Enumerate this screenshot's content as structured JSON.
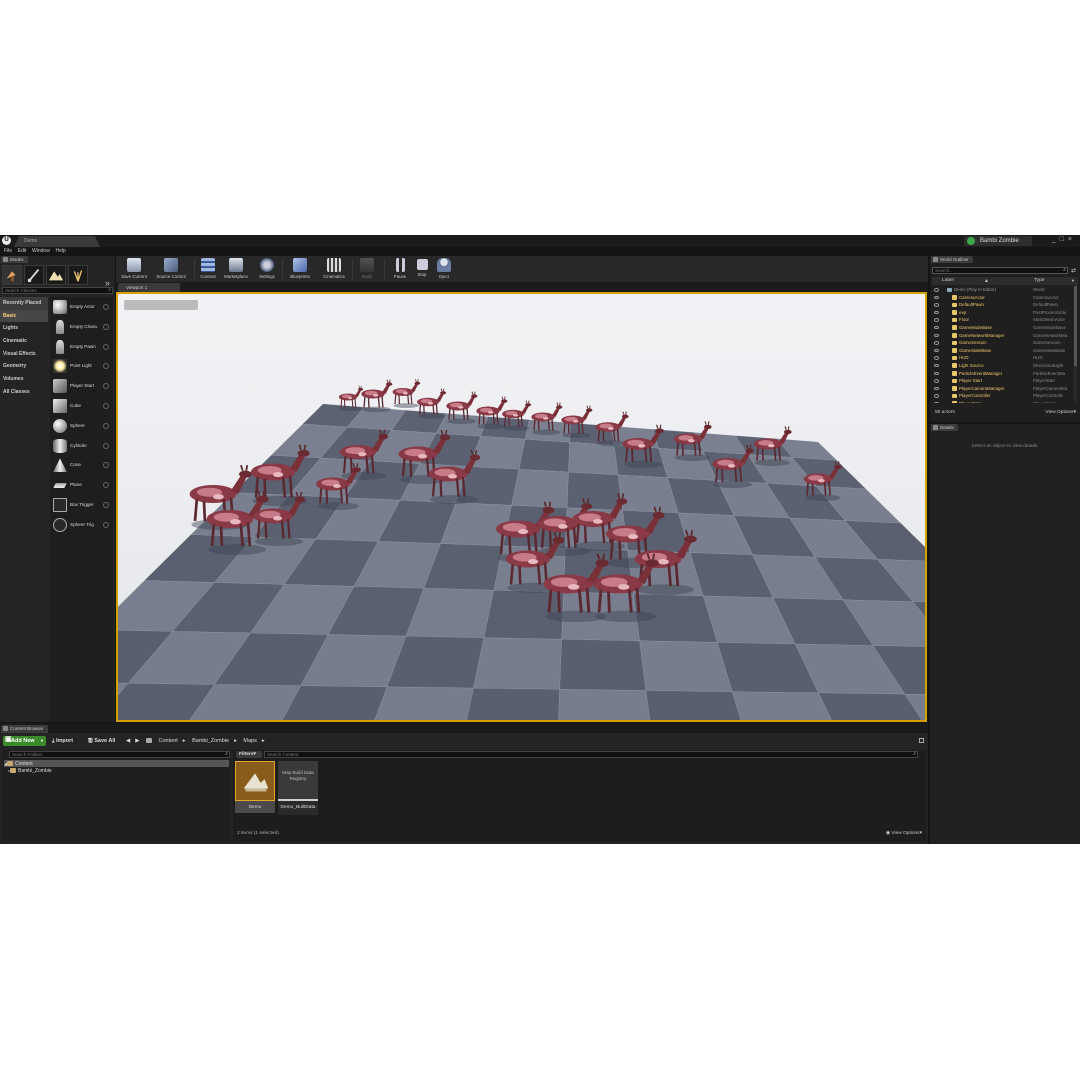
{
  "window": {
    "doc_tab": "Demo",
    "project": "Bambi Zombie",
    "controls": [
      "_",
      "□",
      "×"
    ]
  },
  "menu": [
    "File",
    "Edit",
    "Window",
    "Help"
  ],
  "modes": {
    "tab": "Modes",
    "search_placeholder": "Search Classes",
    "categories": [
      "Recently Placed",
      "Basic",
      "Lights",
      "Cinematic",
      "Visual Effects",
      "Geometry",
      "Volumes",
      "All Classes"
    ],
    "active_category": "Basic",
    "items": [
      "Empty Actor",
      "Empty Chara",
      "Empty Pawn",
      "Point Light",
      "Player Start",
      "Cube",
      "Sphere",
      "Cylinder",
      "Cone",
      "Plane",
      "Box Trigger",
      "Sphere Trig"
    ]
  },
  "toolbar": {
    "buttons": [
      "Save Current",
      "Source Control",
      "Content",
      "Marketplace",
      "Settings",
      "Blueprints",
      "Cinematics",
      "Build",
      "Pause",
      "Stop",
      "Eject"
    ]
  },
  "viewport": {
    "tab": "Viewport 1"
  },
  "outliner": {
    "tab": "World Outliner",
    "search_placeholder": "Search...",
    "col_label": "Label",
    "col_type": "Type",
    "rows": [
      {
        "label": "Demo (Play In Editor)",
        "type": "World"
      },
      {
        "label": "CameraActor",
        "type": "CameraActor"
      },
      {
        "label": "DefaultPawn",
        "type": "DefaultPawn"
      },
      {
        "label": "evp",
        "type": "PostProcessVolu"
      },
      {
        "label": "Floor",
        "type": "StaticMeshActor"
      },
      {
        "label": "GameModeBase",
        "type": "GameModeBase"
      },
      {
        "label": "GameNetworkManager",
        "type": "GameNetworkMa"
      },
      {
        "label": "GameSession",
        "type": "GameSession"
      },
      {
        "label": "GameStateBase",
        "type": "GameStateBase"
      },
      {
        "label": "HUD",
        "type": "HUD"
      },
      {
        "label": "Light Source",
        "type": "DirectionalLight"
      },
      {
        "label": "ParticleEventManager",
        "type": "ParticleEventMa"
      },
      {
        "label": "Player Start",
        "type": "PlayerStart"
      },
      {
        "label": "PlayerCameraManager",
        "type": "PlayerCameraMa"
      },
      {
        "label": "PlayerController",
        "type": "PlayerControlle"
      },
      {
        "label": "PlayerState",
        "type": "PlayerState"
      }
    ],
    "count": "55 actors",
    "view_options": "View Options▾"
  },
  "details": {
    "tab": "Details",
    "empty_message": "Select an object to view details."
  },
  "content_browser": {
    "tab": "Content Browser",
    "add_new": "Add New",
    "import": "Import",
    "save_all": "Save All",
    "breadcrumbs": [
      "Content",
      "Bambi_Zombie",
      "Maps"
    ],
    "folder_search_placeholder": "Search Folders",
    "filters": "Filters▾",
    "asset_search_placeholder": "Search Content",
    "tree": [
      "Content",
      "Bambi_Zombie"
    ],
    "assets": [
      {
        "name": "Demo",
        "thumb_text": ""
      },
      {
        "name": "Demo_BuiltData",
        "thumb_text": "Map Build Data Registry"
      }
    ],
    "status": "2 items (1 selected)",
    "view_options": "View Options▾"
  }
}
